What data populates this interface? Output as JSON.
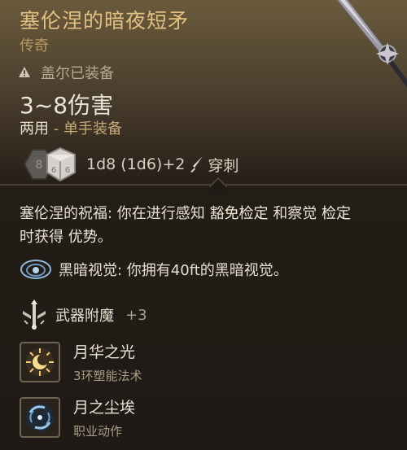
{
  "item": {
    "name": "塞伦涅的暗夜短矛",
    "rarity": "传奇",
    "equipped_by": "盖尔已装备",
    "damage": "3~8伤害",
    "handedness": "两用",
    "handedness_separator": " - ",
    "equip_mode": "单手装备",
    "dice": [
      "8",
      "6"
    ],
    "dice_formula": "1d8 (1d6)+2",
    "damage_type": "穿刺"
  },
  "blessing": {
    "name": "塞伦涅的祝福",
    "colon": ": ",
    "text_1": "你在进行感知 ",
    "kw_1": "豁免检定",
    "text_2": " 和察觉 ",
    "kw_2": "检定",
    "text_3": "时获得 ",
    "kw_3": "优势",
    "end": "。"
  },
  "darkvision": {
    "label": "黑暗视觉: 你拥有40ft的黑暗视觉。"
  },
  "enchantment": {
    "label": "武器附魔",
    "bonus": "+3"
  },
  "actions": [
    {
      "name": "月华之光",
      "sub": "3环塑能法术",
      "icon": "moon-sun-icon"
    },
    {
      "name": "月之尘埃",
      "sub": "职业动作",
      "icon": "swirl-icon"
    }
  ],
  "colors": {
    "title": "#e2c081",
    "rarity": "#b79962",
    "accent": "#c4a975"
  }
}
